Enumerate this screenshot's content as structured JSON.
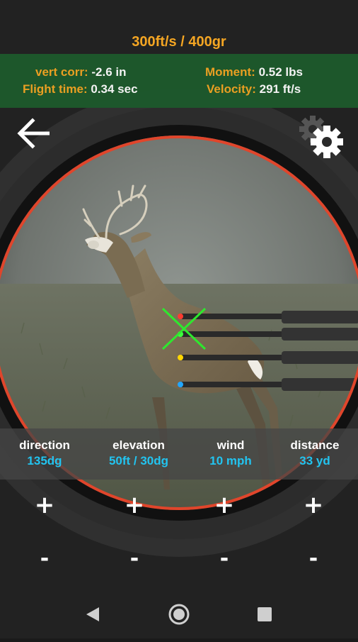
{
  "header": {
    "title": "300ft/s / 400gr"
  },
  "stats": {
    "vert_corr_label": "vert corr:",
    "vert_corr_value": "-2.6 in",
    "flight_time_label": "Flight time:",
    "flight_time_value": "0.34 sec",
    "moment_label": "Moment:",
    "moment_value": "0.52 lbs",
    "velocity_label": "Velocity:",
    "velocity_value": "291 ft/s"
  },
  "icons": {
    "back": "back-arrow-icon",
    "settings": "gear-icon"
  },
  "sight_pins": [
    "red",
    "green",
    "yellow",
    "blue"
  ],
  "colors": {
    "accent_orange": "#f5a623",
    "value_cyan": "#22c4f0",
    "panel_green": "#1d5a2c",
    "scope_ring": "#e0452b",
    "crosshair": "#2ee82e"
  },
  "controls": [
    {
      "name": "direction",
      "value": "135dg",
      "plus": "+",
      "minus": "-"
    },
    {
      "name": "elevation",
      "value": "50ft / 30dg",
      "plus": "+",
      "minus": "-"
    },
    {
      "name": "wind",
      "value": "10 mph",
      "plus": "+",
      "minus": "-"
    },
    {
      "name": "distance",
      "value": "33 yd",
      "plus": "+",
      "minus": "-"
    }
  ]
}
